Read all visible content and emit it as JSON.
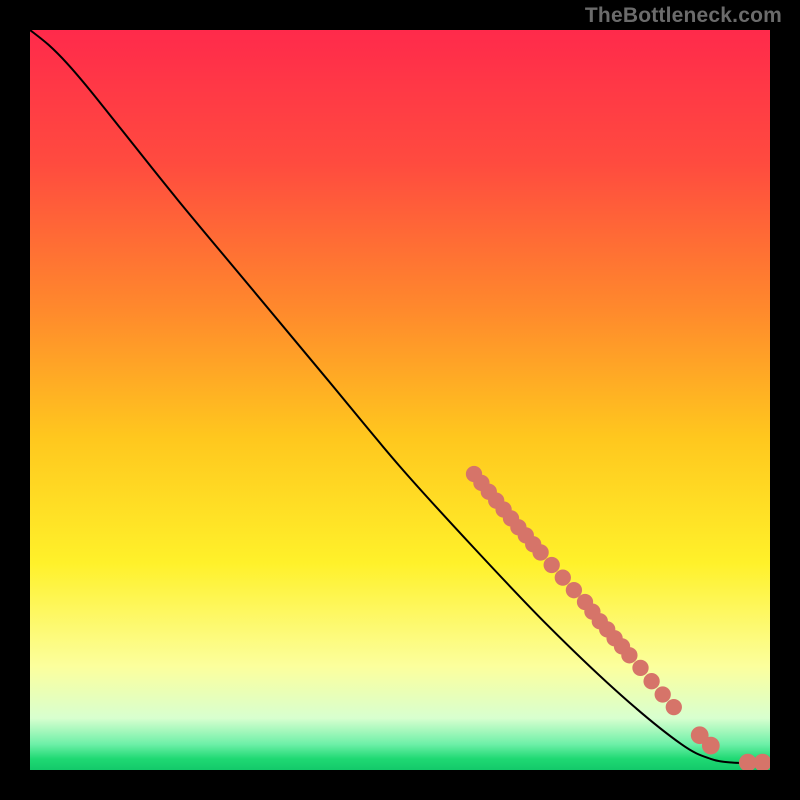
{
  "attribution": "TheBottleneck.com",
  "chart_data": {
    "type": "line",
    "title": "",
    "xlabel": "",
    "ylabel": "",
    "xlim": [
      0,
      100
    ],
    "ylim": [
      0,
      100
    ],
    "gradient_stops": [
      {
        "offset": 0.0,
        "color": "#ff2a4b"
      },
      {
        "offset": 0.18,
        "color": "#ff4b3f"
      },
      {
        "offset": 0.38,
        "color": "#ff8a2c"
      },
      {
        "offset": 0.55,
        "color": "#ffc71e"
      },
      {
        "offset": 0.72,
        "color": "#fff12a"
      },
      {
        "offset": 0.86,
        "color": "#fcff9d"
      },
      {
        "offset": 0.93,
        "color": "#d8ffcf"
      },
      {
        "offset": 0.965,
        "color": "#6ef0a8"
      },
      {
        "offset": 0.985,
        "color": "#1fd973"
      },
      {
        "offset": 1.0,
        "color": "#13c96a"
      }
    ],
    "curve": [
      {
        "x": 0.0,
        "y": 100.0
      },
      {
        "x": 2.5,
        "y": 98.0
      },
      {
        "x": 5.0,
        "y": 95.5
      },
      {
        "x": 8.0,
        "y": 92.0
      },
      {
        "x": 12.0,
        "y": 87.0
      },
      {
        "x": 20.0,
        "y": 77.0
      },
      {
        "x": 30.0,
        "y": 65.0
      },
      {
        "x": 40.0,
        "y": 53.0
      },
      {
        "x": 50.0,
        "y": 41.0
      },
      {
        "x": 60.0,
        "y": 30.0
      },
      {
        "x": 70.0,
        "y": 19.5
      },
      {
        "x": 80.0,
        "y": 10.0
      },
      {
        "x": 88.0,
        "y": 3.5
      },
      {
        "x": 92.0,
        "y": 1.5
      },
      {
        "x": 95.0,
        "y": 1.0
      },
      {
        "x": 98.0,
        "y": 1.0
      },
      {
        "x": 100.0,
        "y": 1.0
      }
    ],
    "markers": [
      {
        "x": 60.0,
        "y": 40.0,
        "r": 1.1
      },
      {
        "x": 61.0,
        "y": 38.8,
        "r": 1.1
      },
      {
        "x": 62.0,
        "y": 37.6,
        "r": 1.1
      },
      {
        "x": 63.0,
        "y": 36.4,
        "r": 1.1
      },
      {
        "x": 64.0,
        "y": 35.2,
        "r": 1.1
      },
      {
        "x": 65.0,
        "y": 34.0,
        "r": 1.1
      },
      {
        "x": 66.0,
        "y": 32.8,
        "r": 1.1
      },
      {
        "x": 67.0,
        "y": 31.7,
        "r": 1.1
      },
      {
        "x": 68.0,
        "y": 30.5,
        "r": 1.1
      },
      {
        "x": 69.0,
        "y": 29.4,
        "r": 1.1
      },
      {
        "x": 70.5,
        "y": 27.7,
        "r": 1.1
      },
      {
        "x": 72.0,
        "y": 26.0,
        "r": 1.1
      },
      {
        "x": 73.5,
        "y": 24.3,
        "r": 1.1
      },
      {
        "x": 75.0,
        "y": 22.7,
        "r": 1.1
      },
      {
        "x": 76.0,
        "y": 21.4,
        "r": 1.1
      },
      {
        "x": 77.0,
        "y": 20.1,
        "r": 1.1
      },
      {
        "x": 78.0,
        "y": 19.0,
        "r": 1.1
      },
      {
        "x": 79.0,
        "y": 17.8,
        "r": 1.1
      },
      {
        "x": 80.0,
        "y": 16.7,
        "r": 1.1
      },
      {
        "x": 81.0,
        "y": 15.5,
        "r": 1.1
      },
      {
        "x": 82.5,
        "y": 13.8,
        "r": 1.1
      },
      {
        "x": 84.0,
        "y": 12.0,
        "r": 1.1
      },
      {
        "x": 85.5,
        "y": 10.2,
        "r": 1.1
      },
      {
        "x": 87.0,
        "y": 8.5,
        "r": 1.1
      },
      {
        "x": 90.5,
        "y": 4.7,
        "r": 1.2
      },
      {
        "x": 92.0,
        "y": 3.3,
        "r": 1.2
      },
      {
        "x": 97.0,
        "y": 1.0,
        "r": 1.2
      },
      {
        "x": 99.0,
        "y": 1.0,
        "r": 1.2
      }
    ]
  }
}
